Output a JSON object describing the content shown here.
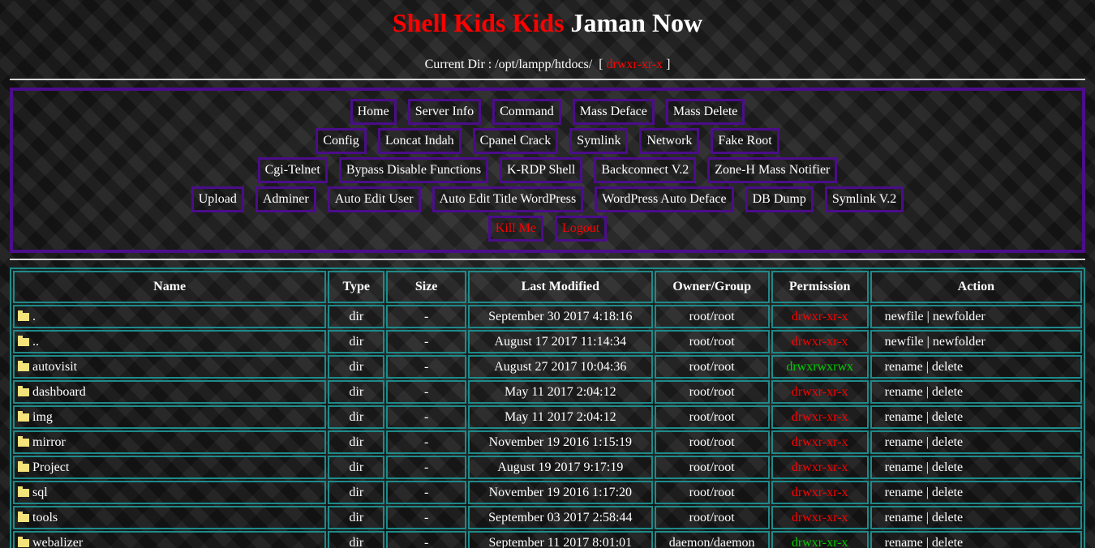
{
  "title": {
    "part_red": "Shell Kids Kids",
    "part_white": "Jaman Now"
  },
  "current_dir": {
    "label": "Current Dir :",
    "path": "/opt/lampp/htdocs/",
    "open_bracket": "[",
    "permission": "drwxr-xr-x",
    "close_bracket": "]"
  },
  "menu": {
    "rows": [
      [
        "Home",
        "Server Info",
        "Command",
        "Mass Deface",
        "Mass Delete"
      ],
      [
        "Config",
        "Loncat Indah",
        "Cpanel Crack",
        "Symlink",
        "Network",
        "Fake Root"
      ],
      [
        "Cgi-Telnet",
        "Bypass Disable Functions",
        "K-RDP Shell",
        "Backconnect V.2",
        "Zone-H Mass Notifier"
      ],
      [
        "Upload",
        "Adminer",
        "Auto Edit User",
        "Auto Edit Title WordPress",
        "WordPress Auto Deface",
        "DB Dump",
        "Symlink V.2"
      ],
      [
        "Kill Me",
        "Logout"
      ]
    ]
  },
  "table": {
    "headers": [
      "Name",
      "Type",
      "Size",
      "Last Modified",
      "Owner/Group",
      "Permission",
      "Action"
    ],
    "rows": [
      {
        "name": ".",
        "type": "dir",
        "size": "-",
        "modified": "September 30 2017 4:18:16",
        "owner": "root/root",
        "perm": "drwxr-xr-x",
        "writable": false,
        "a1": "newfile",
        "sep": "|",
        "a2": "newfolder"
      },
      {
        "name": "..",
        "type": "dir",
        "size": "-",
        "modified": "August 17 2017 11:14:34",
        "owner": "root/root",
        "perm": "drwxr-xr-x",
        "writable": false,
        "a1": "newfile",
        "sep": "|",
        "a2": "newfolder"
      },
      {
        "name": "autovisit",
        "type": "dir",
        "size": "-",
        "modified": "August 27 2017 10:04:36",
        "owner": "root/root",
        "perm": "drwxrwxrwx",
        "writable": true,
        "a1": "rename",
        "sep": "|",
        "a2": "delete"
      },
      {
        "name": "dashboard",
        "type": "dir",
        "size": "-",
        "modified": "May 11 2017 2:04:12",
        "owner": "root/root",
        "perm": "drwxr-xr-x",
        "writable": false,
        "a1": "rename",
        "sep": "|",
        "a2": "delete"
      },
      {
        "name": "img",
        "type": "dir",
        "size": "-",
        "modified": "May 11 2017 2:04:12",
        "owner": "root/root",
        "perm": "drwxr-xr-x",
        "writable": false,
        "a1": "rename",
        "sep": "|",
        "a2": "delete"
      },
      {
        "name": "mirror",
        "type": "dir",
        "size": "-",
        "modified": "November 19 2016 1:15:19",
        "owner": "root/root",
        "perm": "drwxr-xr-x",
        "writable": false,
        "a1": "rename",
        "sep": "|",
        "a2": "delete"
      },
      {
        "name": "Project",
        "type": "dir",
        "size": "-",
        "modified": "August 19 2017 9:17:19",
        "owner": "root/root",
        "perm": "drwxr-xr-x",
        "writable": false,
        "a1": "rename",
        "sep": "|",
        "a2": "delete"
      },
      {
        "name": "sql",
        "type": "dir",
        "size": "-",
        "modified": "November 19 2016 1:17:20",
        "owner": "root/root",
        "perm": "drwxr-xr-x",
        "writable": false,
        "a1": "rename",
        "sep": "|",
        "a2": "delete"
      },
      {
        "name": "tools",
        "type": "dir",
        "size": "-",
        "modified": "September 03 2017 2:58:44",
        "owner": "root/root",
        "perm": "drwxr-xr-x",
        "writable": false,
        "a1": "rename",
        "sep": "|",
        "a2": "delete"
      },
      {
        "name": "webalizer",
        "type": "dir",
        "size": "-",
        "modified": "September 11 2017 8:01:01",
        "owner": "daemon/daemon",
        "perm": "drwxr-xr-x",
        "writable": true,
        "a1": "rename",
        "sep": "|",
        "a2": "delete"
      }
    ]
  },
  "colors": {
    "accent_red": "#ff0000",
    "writable_green": "#00cc00",
    "menu_border": "#4b0d8a",
    "table_border": "#1e8a8a",
    "folder_icon": "#f4e27a"
  },
  "icons": {
    "row_icon": "folder-icon"
  }
}
